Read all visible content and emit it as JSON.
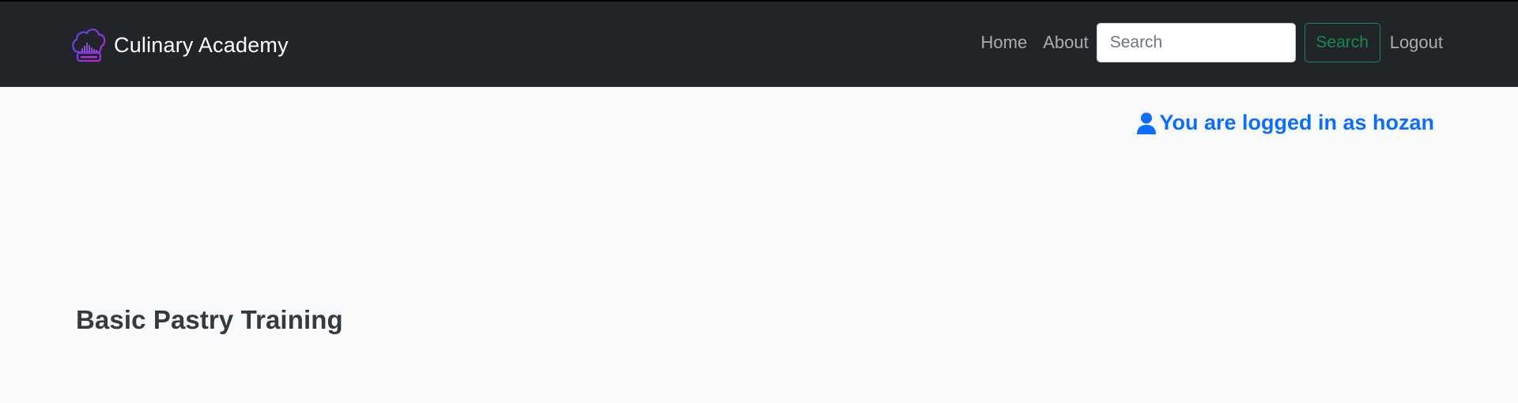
{
  "header": {
    "brand": {
      "name": "Culinary Academy",
      "logo_icon": "chef-hat-icon"
    },
    "nav": {
      "home_label": "Home",
      "about_label": "About",
      "search_placeholder": "Search",
      "search_value": "",
      "search_button_label": "Search",
      "logout_label": "Logout"
    }
  },
  "main": {
    "login_status": {
      "icon": "user-icon",
      "text": "You are logged in as hozan"
    },
    "title": "Basic Pastry Training"
  },
  "colors": {
    "navbar_bg": "#212529",
    "page_bg": "#f8f9fa",
    "accent_blue": "#0d6efd",
    "search_green": "#198754",
    "title_text": "#343a40"
  }
}
